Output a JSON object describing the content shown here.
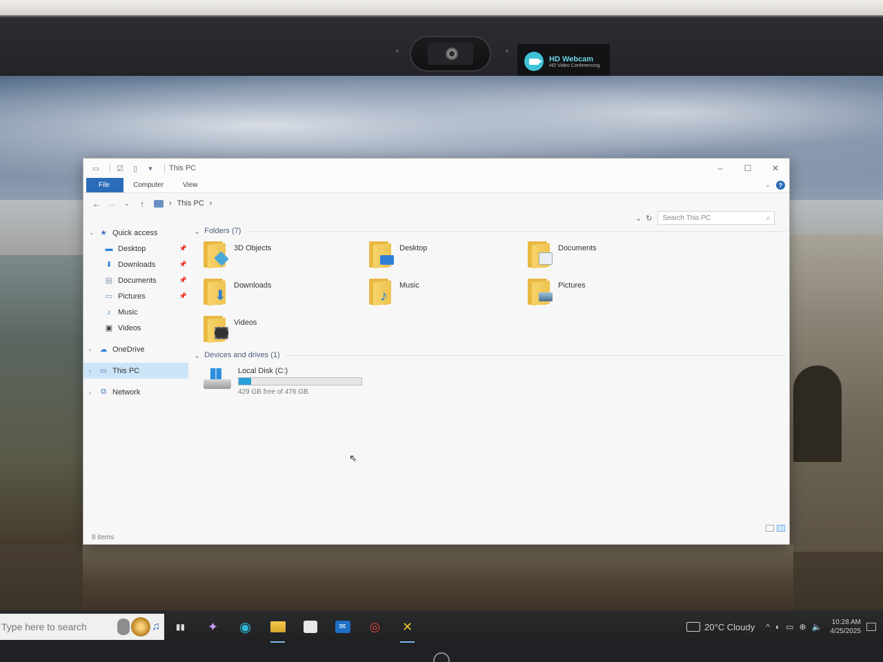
{
  "webcam": {
    "brand": "HD Webcam",
    "subtitle": "HD Video Conferencing",
    "badge_color": "#3fc2d6"
  },
  "window": {
    "title": "This PC",
    "controls": {
      "minimize": "–",
      "maximize": "☐",
      "close": "✕"
    }
  },
  "ribbon": {
    "tabs": [
      {
        "label": "File",
        "active": true
      },
      {
        "label": "Computer"
      },
      {
        "label": "View"
      }
    ],
    "help": "?"
  },
  "navbar": {
    "back": "←",
    "forward": "→",
    "recent": "⌄",
    "up": "↑",
    "breadcrumb": [
      "This PC"
    ],
    "search_placeholder": "Search This PC"
  },
  "nav_pane": {
    "quick_access": "Quick access",
    "items": [
      {
        "label": "Desktop",
        "icon": "desktop-icon",
        "pinned": true
      },
      {
        "label": "Downloads",
        "icon": "downloads-icon",
        "pinned": true
      },
      {
        "label": "Documents",
        "icon": "documents-icon",
        "pinned": true
      },
      {
        "label": "Pictures",
        "icon": "pictures-icon",
        "pinned": true
      },
      {
        "label": "Music",
        "icon": "music-icon",
        "pinned": false
      },
      {
        "label": "Videos",
        "icon": "videos-icon",
        "pinned": false
      }
    ],
    "onedrive": "OneDrive",
    "this_pc": "This PC",
    "network": "Network"
  },
  "content": {
    "folders_header": "Folders (7)",
    "folders": [
      {
        "label": "3D Objects",
        "icon": "3d-objects-folder-icon",
        "emblem_color": "#4aa8d8"
      },
      {
        "label": "Desktop",
        "icon": "desktop-folder-icon",
        "emblem_color": "#2f7fd6"
      },
      {
        "label": "Documents",
        "icon": "documents-folder-icon",
        "emblem_color": "#e9eef5"
      },
      {
        "label": "Downloads",
        "icon": "downloads-folder-icon",
        "emblem_color": "#2f7fd6"
      },
      {
        "label": "Music",
        "icon": "music-folder-icon",
        "emblem_color": "#2f7fd6"
      },
      {
        "label": "Pictures",
        "icon": "pictures-folder-icon",
        "emblem_color": "#6fa0c8"
      },
      {
        "label": "Videos",
        "icon": "videos-folder-icon",
        "emblem_color": "#333333"
      }
    ],
    "drives_header": "Devices and drives (1)",
    "drive": {
      "name": "Local Disk (C:)",
      "free_text": "429 GB free of 476 GB",
      "used_fraction": 0.099
    }
  },
  "status": {
    "items": "8 items"
  },
  "taskbar": {
    "search_placeholder": "Type here to search",
    "apps": [
      {
        "name": "task-view",
        "glyph": "▮▮"
      },
      {
        "name": "copilot",
        "glyph": "✦"
      },
      {
        "name": "edge",
        "glyph": "◉"
      },
      {
        "name": "file-explorer",
        "glyph": "▬",
        "active": true
      },
      {
        "name": "microsoft-store",
        "glyph": "▦"
      },
      {
        "name": "outlook",
        "glyph": "✉"
      },
      {
        "name": "media-app",
        "glyph": "◎"
      },
      {
        "name": "pinned-app",
        "glyph": "✕",
        "active": true
      }
    ],
    "weather": "20°C  Cloudy",
    "time": "10:28 AM",
    "date": "4/25/2025"
  }
}
